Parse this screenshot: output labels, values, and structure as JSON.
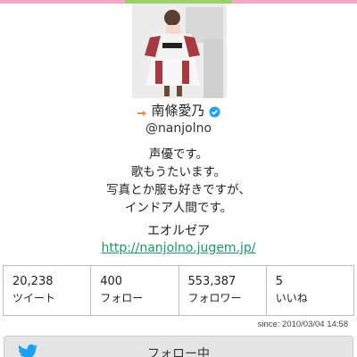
{
  "profile": {
    "display_name": "南條愛乃",
    "handle": "@nanjolno",
    "bio_lines": [
      "声優です。",
      "歌もうたいます。",
      "写真とか服も好きですが、",
      "インドア人間です。"
    ],
    "location": "エオルゼア",
    "url": "http://nanjolno.jugem.jp/",
    "since": "since: 2010/03/04 14:58"
  },
  "stats": [
    {
      "value": "20,238",
      "label": "ツイート"
    },
    {
      "value": "400",
      "label": "フォロー"
    },
    {
      "value": "553,387",
      "label": "フォロワー"
    },
    {
      "value": "5",
      "label": "いいね"
    }
  ],
  "follow_button": {
    "label": "フォロー中"
  },
  "colors": {
    "accent_top": "#f3a8c6",
    "accent_top_mid": "#9bd06a",
    "link": "#1a9a68",
    "verified": "#1da1f2",
    "twitter_bird": "#1da1f2",
    "retweet": "#f08a3c"
  },
  "icons": {
    "retweet": "retweet-icon",
    "verified": "verified-badge-icon",
    "bird": "twitter-bird-icon"
  }
}
